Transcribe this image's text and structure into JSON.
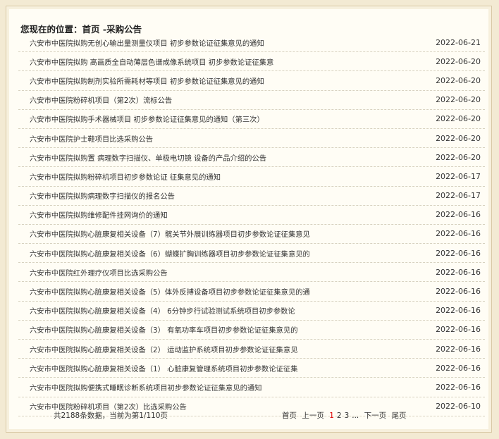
{
  "breadcrumb": {
    "label": "您现在的位置：",
    "home": "首页",
    "sep": " -",
    "current": "采购公告"
  },
  "items": [
    {
      "title": "六安市中医院拟购无创心输出量测量仪项目 初步参数论证征集意见的通知",
      "date": "2022-06-21"
    },
    {
      "title": "六安市中医院拟购 高画质全自动薄层色谱成像系统项目 初步参数论证征集意",
      "date": "2022-06-20"
    },
    {
      "title": "六安市中医院拟购制剂实验所需耗材等项目 初步参数论证征集意见的通知",
      "date": "2022-06-20"
    },
    {
      "title": "六安市中医院粉碎机项目（第2次）流标公告",
      "date": "2022-06-20"
    },
    {
      "title": "六安市中医院拟购手术器械项目 初步参数论证征集意见的通知（第三次）",
      "date": "2022-06-20"
    },
    {
      "title": "六安市中医院护士鞋项目比选采购公告",
      "date": "2022-06-20"
    },
    {
      "title": "六安市中医院拟购置 病理数字扫描仪、单极电切镜 设备的产品介绍的公告",
      "date": "2022-06-20"
    },
    {
      "title": "六安市中医院拟购粉碎机项目初步参数论证 征集意见的通知",
      "date": "2022-06-17"
    },
    {
      "title": "六安市中医院拟购病理数字扫描仪的报名公告",
      "date": "2022-06-17"
    },
    {
      "title": "六安市中医院拟购维修配件挂网询价的通知",
      "date": "2022-06-16"
    },
    {
      "title": "六安市中医院拟购心脏康复相关设备（7）髋关节外展训练器项目初步参数论证征集意见",
      "date": "2022-06-16"
    },
    {
      "title": "六安市中医院拟购心脏康复相关设备（6）蝴蝶扩胸训练器项目初步参数论证征集意见的",
      "date": "2022-06-16"
    },
    {
      "title": "六安市中医院红外理疗仪项目比选采购公告",
      "date": "2022-06-16"
    },
    {
      "title": "六安市中医院拟购心脏康复相关设备（5）体外反搏设备项目初步参数论证征集意见的通",
      "date": "2022-06-16"
    },
    {
      "title": "六安市中医院拟购心脏康复相关设备（4） 6分钟步行试验测试系统项目初步参数论",
      "date": "2022-06-16"
    },
    {
      "title": "六安市中医院拟购心脏康复相关设备（3） 有氧功率车项目初步参数论证征集意见的",
      "date": "2022-06-16"
    },
    {
      "title": "六安市中医院拟购心脏康复相关设备（2） 运动监护系统项目初步参数论证征集意见",
      "date": "2022-06-16"
    },
    {
      "title": "六安市中医院拟购心脏康复相关设备（1） 心脏康复管理系统项目初步参数论证征集",
      "date": "2022-06-16"
    },
    {
      "title": "六安市中医院拟购便携式睡眠诊断系统项目初步参数论证征集意见的通知",
      "date": "2022-06-16"
    },
    {
      "title": "六安市中医院粉碎机项目（第2次）比选采购公告",
      "date": "2022-06-10"
    }
  ],
  "pager": {
    "info": "共2188条数据，当前为第1/110页",
    "first": "首页",
    "prev": "上一页",
    "pages": [
      "1",
      "2",
      "3"
    ],
    "current": "1",
    "ellipsis": "...",
    "next": "下一页",
    "last": "尾页"
  }
}
